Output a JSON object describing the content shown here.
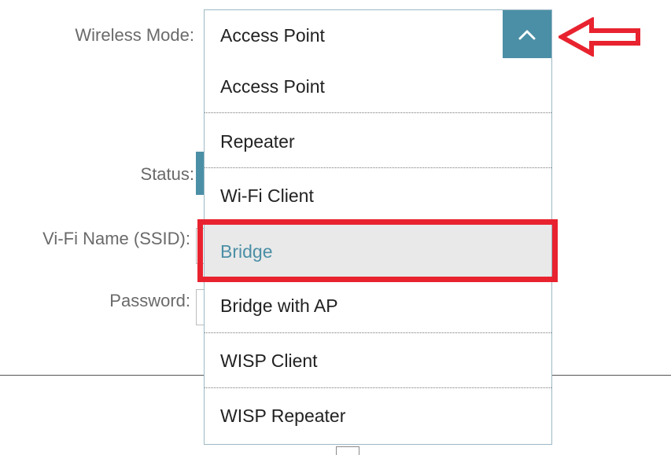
{
  "form": {
    "wireless_mode_label": "Wireless Mode:",
    "status_label": "Status:",
    "ssid_label": "Vi-Fi Name (SSID):",
    "password_label": "Password:"
  },
  "wireless_mode_select": {
    "selected_value": "Access Point",
    "toggle_icon": "chevron-up-icon",
    "expanded": true,
    "options": [
      {
        "label": "Access Point"
      },
      {
        "label": "Repeater"
      },
      {
        "label": "Wi-Fi Client"
      },
      {
        "label": "Bridge",
        "highlighted": true
      },
      {
        "label": "Bridge with AP"
      },
      {
        "label": "WISP Client"
      },
      {
        "label": "WISP Repeater"
      }
    ]
  },
  "annotations": {
    "arrow_icon": "arrow-left-outline-icon",
    "highlight_box_target": "Bridge",
    "color": "#e8232f"
  },
  "colors": {
    "accent": "#4b8fa6",
    "highlight_background": "#e9e9e9",
    "annotation_red": "#e8232f"
  }
}
